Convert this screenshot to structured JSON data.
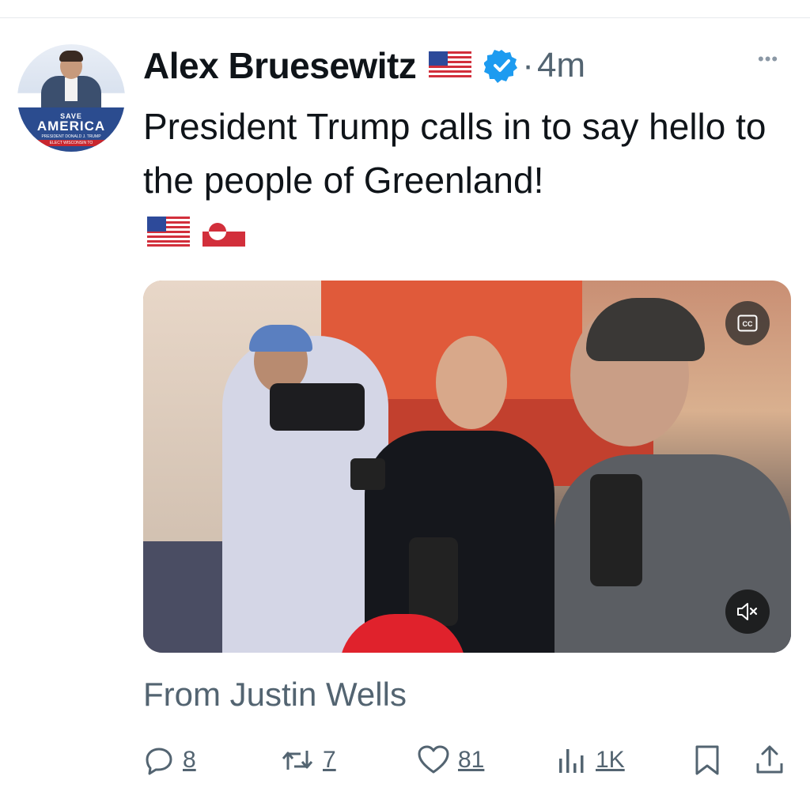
{
  "author": {
    "name": "Alex Bruesewitz",
    "name_flag_icon": "us-flag-icon",
    "verified_icon": "verified-badge-icon",
    "separator": "·",
    "time": "4m",
    "avatar_sign": {
      "top": "SAVE",
      "main": "AMERICA",
      "sub": "PRESIDENT DONALD J. TRUMP",
      "strip": "ELECT WISCONSIN TO"
    }
  },
  "more_icon": "more-options-icon",
  "tweet": {
    "text": "President Trump calls in to say hello to the people of Greenland!",
    "emoji_flags": [
      "us-flag-icon",
      "greenland-flag-icon"
    ]
  },
  "media": {
    "cc_label": "CC",
    "mute_icon": "muted-speaker-icon"
  },
  "attribution": "From Justin Wells",
  "actions": {
    "reply_count": "8",
    "retweet_count": "7",
    "like_count": "81",
    "views_count": "1K"
  },
  "colors": {
    "text_primary": "#0f1419",
    "text_secondary": "#536471",
    "verified_blue": "#1d9bf0"
  }
}
